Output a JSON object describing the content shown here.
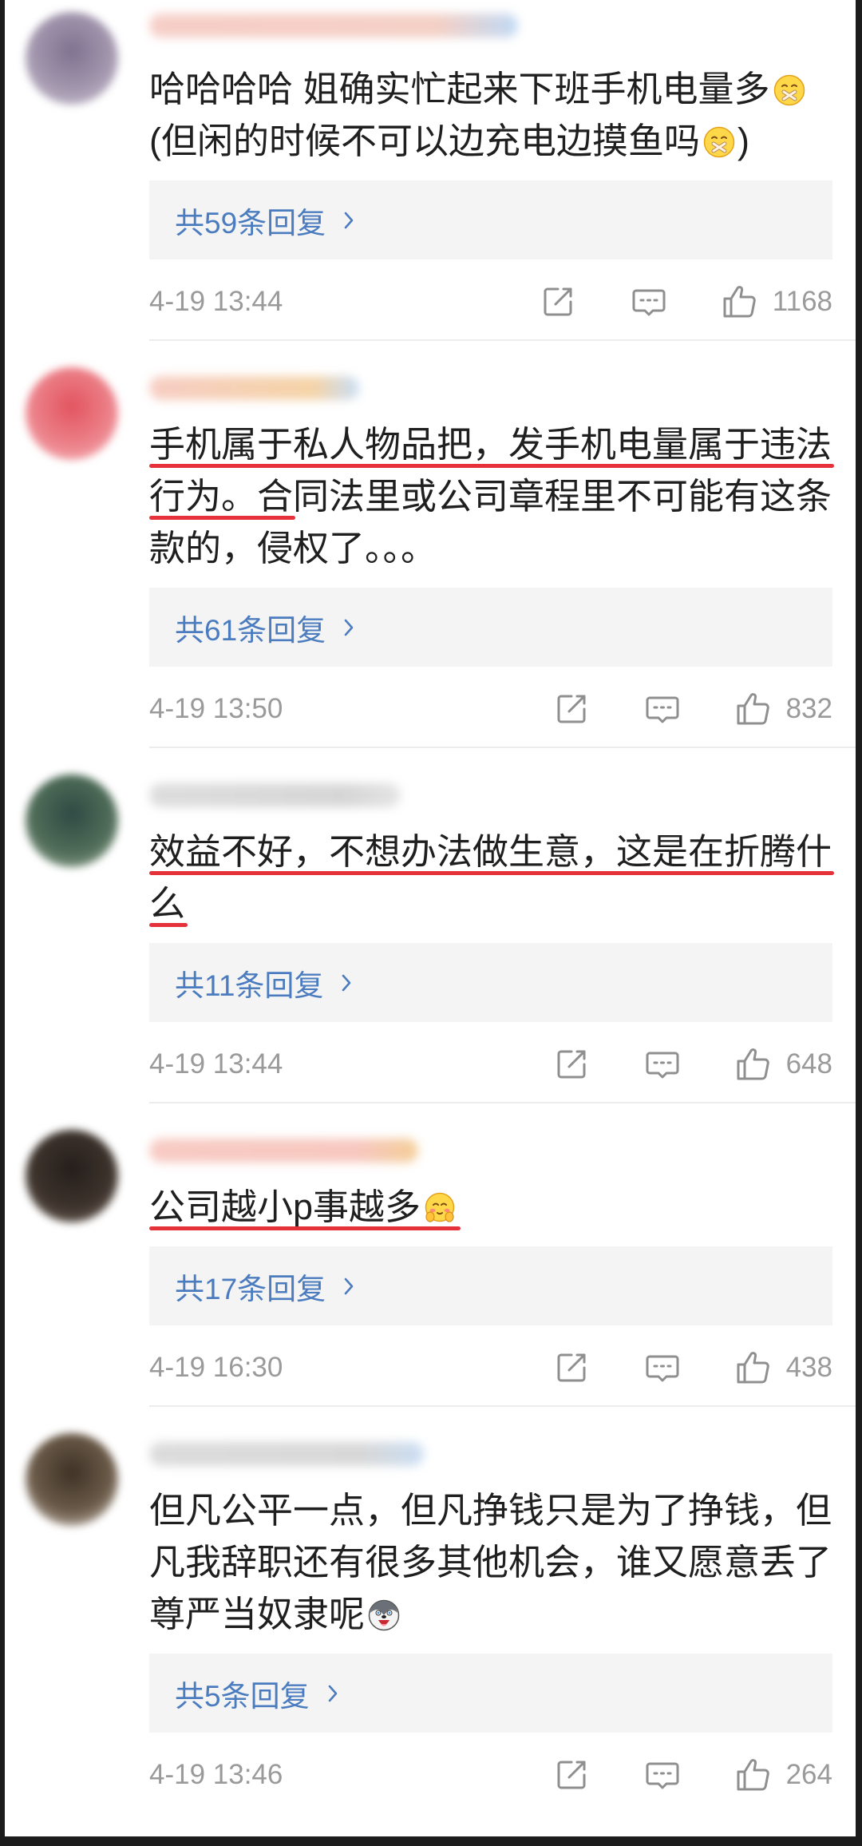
{
  "colors": {
    "text": "#1f1f1f",
    "reply_link": "#4a7cbf",
    "reply_bg": "#f4f4f4",
    "meta": "#9a9a9a",
    "icon": "#8f8f8f",
    "underline": "#e4313a",
    "divider": "#ececec"
  },
  "comments": [
    {
      "avatar_colors": [
        "#7e7290",
        "#a397ae",
        "#d4cdda"
      ],
      "name_blur_colors": [
        "#f5c9c1",
        "#f3cbbf",
        "#b9d5f3"
      ],
      "lines": [
        [
          {
            "text": "哈哈哈哈 姐确实忙起来下班手机电量多"
          },
          {
            "emoji": "sealed-mouth"
          }
        ],
        [
          {
            "text": "(但闲的时候不可以边充电边摸鱼吗"
          },
          {
            "emoji": "sealed-mouth"
          },
          {
            "text": ")"
          }
        ]
      ],
      "replies_label": "共59条回复",
      "time": "4-19 13:44",
      "likes": "1168"
    },
    {
      "avatar_colors": [
        "#e2545f",
        "#ec8189",
        "#f6c4c7"
      ],
      "name_blur_colors": [
        "#f6c8bd",
        "#f4cf9e",
        "#c2daf4"
      ],
      "lines": [
        [
          {
            "text": "手机属于私人物品把，发手机电量属于违法",
            "underlined": true
          }
        ],
        [
          {
            "text": "行为。合",
            "underlined": true
          },
          {
            "text": "同法里或公司章程里不可能有这条"
          }
        ],
        [
          {
            "text": "款的，侵权了。。。"
          }
        ]
      ],
      "replies_label": "共61条回复",
      "time": "4-19 13:50",
      "likes": "832"
    },
    {
      "avatar_colors": [
        "#2f4a44",
        "#4f6c58",
        "#a9b9a4"
      ],
      "name_blur_colors": [
        "#dadada",
        "#d2d2d2",
        "#e2e2e2"
      ],
      "lines": [
        [
          {
            "text": "效益不好，不想办法做生意，这是在折腾什",
            "underlined": true
          }
        ],
        [
          {
            "text": "么",
            "underlined": true
          }
        ]
      ],
      "replies_label": "共11条回复",
      "time": "4-19 13:44",
      "likes": "648"
    },
    {
      "avatar_colors": [
        "#241e1b",
        "#3d332c",
        "#8a7d72"
      ],
      "name_blur_colors": [
        "#f7c5bd",
        "#f6c2b8",
        "#f3c98c"
      ],
      "lines": [
        [
          {
            "text": "公司越小p事越多",
            "underlined": true
          },
          {
            "emoji": "blushing-hands",
            "underlined": true
          }
        ]
      ],
      "replies_label": "共17条回复",
      "time": "4-19 16:30",
      "likes": "438"
    },
    {
      "avatar_colors": [
        "#3e3226",
        "#6b5a48",
        "#ebe6e1"
      ],
      "name_blur_colors": [
        "#d8d8d8",
        "#d4d4d4",
        "#c4daf3"
      ],
      "lines": [
        [
          {
            "text": "但凡公平一点，但凡挣钱只是为了挣钱，但"
          }
        ],
        [
          {
            "text": "凡我辞职还有很多其他机会，谁又愿意丢了"
          }
        ],
        [
          {
            "text": "尊严当奴隶呢"
          },
          {
            "emoji": "husky"
          }
        ]
      ],
      "replies_label": "共5条回复",
      "time": "4-19 13:46",
      "likes": "264"
    }
  ]
}
